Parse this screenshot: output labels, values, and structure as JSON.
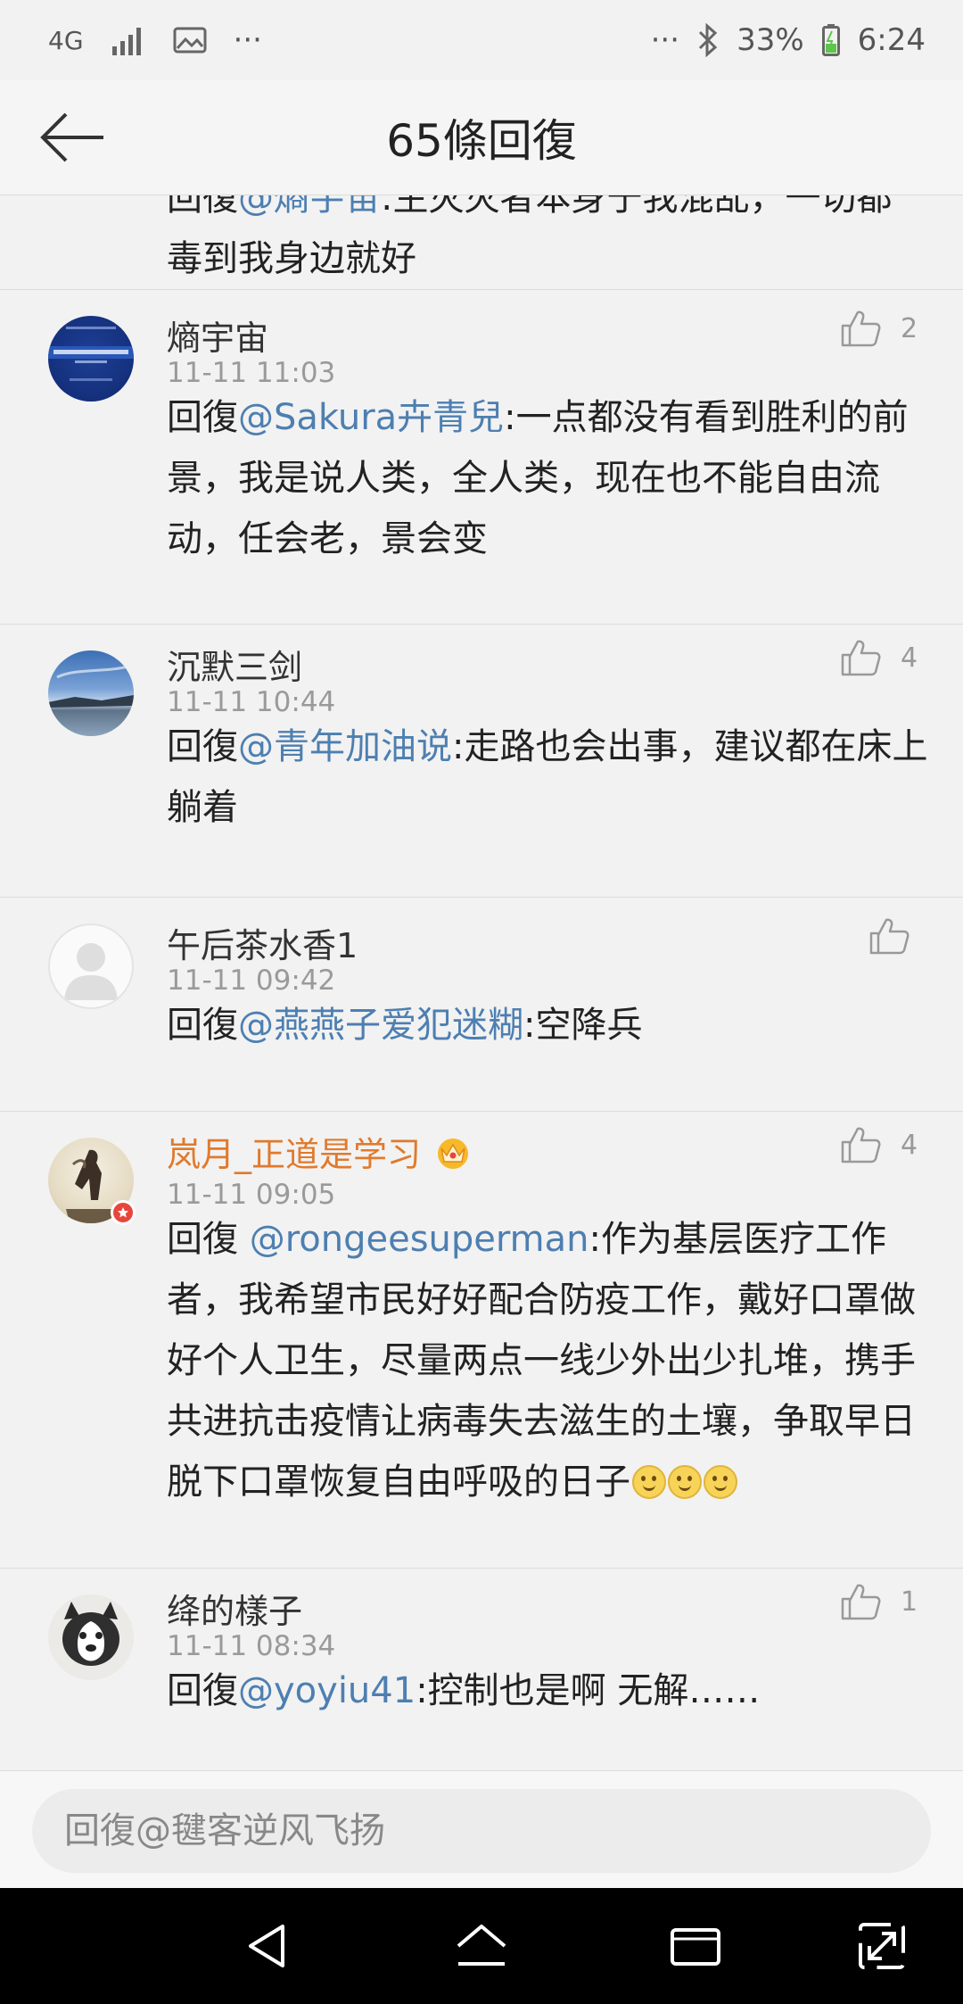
{
  "status_bar": {
    "network": "4G",
    "more_left": "···",
    "more_right": "···",
    "battery": "33%",
    "time": "6:24"
  },
  "header": {
    "title": "65條回復",
    "back_icon": "back-arrow-icon"
  },
  "partial_comment": {
    "line1_prefix": "回復",
    "line1_mention": "@熵宇宙",
    "line1_rest": ":生灭灭者本身于我混乱，一切都",
    "line2": "毒到我身边就好"
  },
  "comments": [
    {
      "username": "熵宇宙",
      "time": "11-11 11:03",
      "likes": "2",
      "prefix": "回復",
      "mention": "@Sakura卉青兒",
      "text": ":一点都没有看到胜利的前景，我是说人类，全人类，现在也不能自由流动，任会老，景会变"
    },
    {
      "username": "沉默三剑",
      "time": "11-11 10:44",
      "likes": "4",
      "prefix": "回復",
      "mention": "@青年加油说",
      "text": ":走路也会出事，建议都在床上躺着"
    },
    {
      "username": "午后茶水香1",
      "time": "11-11 09:42",
      "likes": "",
      "prefix": "回復",
      "mention": "@燕燕子爱犯迷糊",
      "text": ":空降兵"
    },
    {
      "username": "岚月_正道是学习",
      "time": "11-11 09:05",
      "likes": "4",
      "prefix": "回復 ",
      "mention": "@rongeesuperman",
      "text": ":作为基层医疗工作者，我希望市民好好配合防疫工作，戴好口罩做好个人卫生，尽量两点一线少外出少扎堆，携手共进抗击疫情让病毒失去滋生的土壤，争取早日脱下口罩恢复自由呼吸的日子"
    },
    {
      "username": "绛的樣子",
      "time": "11-11 08:34",
      "likes": "1",
      "prefix": "回復",
      "mention": "@yoyiu41",
      "text": ":控制也是啊 无解……"
    }
  ],
  "input": {
    "placeholder": "回復@毽客逆风飞扬"
  },
  "colors": {
    "mention": "#4d7fb1",
    "vip_name": "#e07a2d",
    "background": "#f2f2f2"
  },
  "icons": {
    "like": "thumbs-up-icon",
    "crown": "crown-icon",
    "nav_back": "nav-back-icon",
    "nav_home": "nav-home-icon",
    "nav_recent": "nav-recent-icon",
    "nav_expand": "nav-expand-icon"
  }
}
